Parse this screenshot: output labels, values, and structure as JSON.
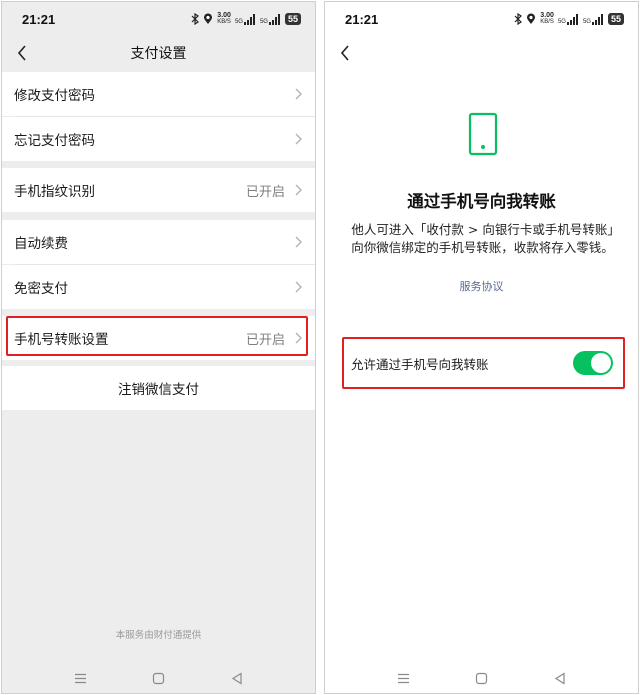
{
  "status_bar": {
    "time": "21:21",
    "speed_value": "3.00",
    "speed_unit": "KB/S",
    "network_1": "5G",
    "network_2": "5G",
    "battery": "55",
    "icons": [
      "bluetooth-icon",
      "location-icon",
      "signal-icon",
      "signal-icon",
      "battery-icon"
    ]
  },
  "left_screen": {
    "title": "支付设置",
    "items": [
      {
        "label": "修改支付密码",
        "value": ""
      },
      {
        "label": "忘记支付密码",
        "value": ""
      },
      {
        "label": "手机指纹识别",
        "value": "已开启"
      },
      {
        "label": "自动续费",
        "value": ""
      },
      {
        "label": "免密支付",
        "value": ""
      },
      {
        "label": "手机号转账设置",
        "value": "已开启"
      }
    ],
    "cancel_label": "注销微信支付",
    "footer": "本服务由财付通提供"
  },
  "right_screen": {
    "title": "通过手机号向我转账",
    "description": "他人可进入「收付款 > 向银行卡或手机号转账」向你微信绑定的手机号转账，收款将存入零钱。",
    "service_link": "服务协议",
    "toggle_label": "允许通过手机号向我转账",
    "toggle_on": true
  },
  "colors": {
    "accent_green": "#07c160",
    "highlight_red": "#e02020",
    "link_blue": "#576b95",
    "background_grey": "#ededed"
  }
}
